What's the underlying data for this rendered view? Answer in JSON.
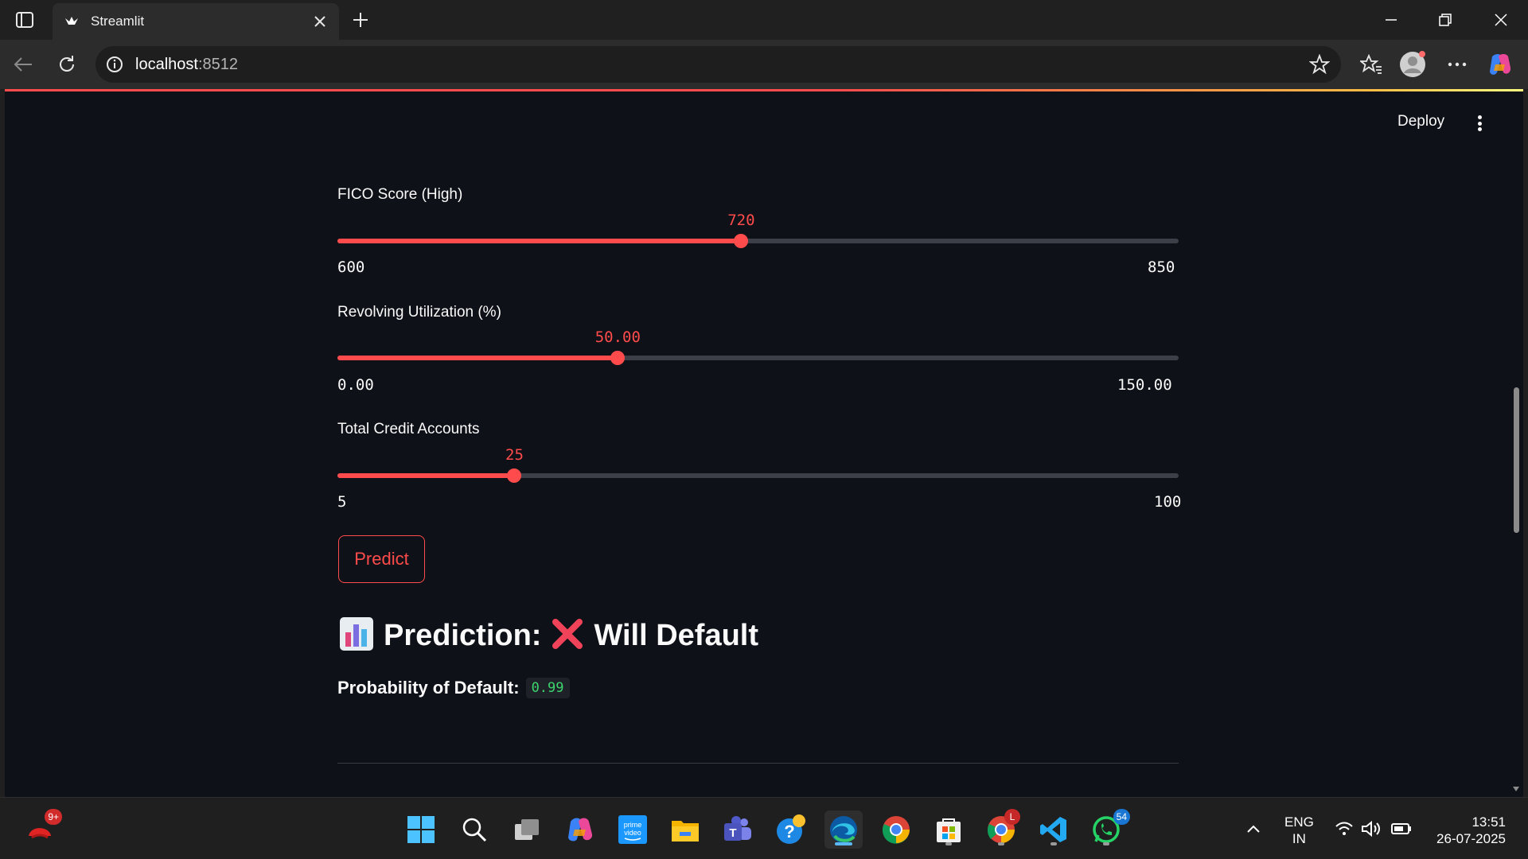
{
  "browser": {
    "tab_title": "Streamlit",
    "url_host": "localhost",
    "url_port": ":8512"
  },
  "app": {
    "deploy_label": "Deploy",
    "sliders": [
      {
        "label": "FICO Score (High)",
        "value": "720",
        "min": "600",
        "max": "850",
        "fraction": 0.48
      },
      {
        "label": "Revolving Utilization (%)",
        "value": "50.00",
        "min": "0.00",
        "max": "150.00",
        "fraction": 0.3333
      },
      {
        "label": "Total Credit Accounts",
        "value": "25",
        "min": "5",
        "max": "100",
        "fraction": 0.2105
      }
    ],
    "predict_label": "Predict",
    "prediction_label": "Prediction:",
    "prediction_value": "Will Default",
    "probability_label": "Probability of Default:",
    "probability_value": "0.99"
  },
  "taskbar": {
    "notification_badge": "9+",
    "chrome_profile_badge": "L",
    "whatsapp_badge": "54",
    "language": "ENG",
    "region": "IN",
    "time": "13:51",
    "date": "26-07-2025"
  },
  "colors": {
    "accent": "#ff4b4b",
    "background": "#0e1117",
    "success_text": "#3dd56d"
  }
}
